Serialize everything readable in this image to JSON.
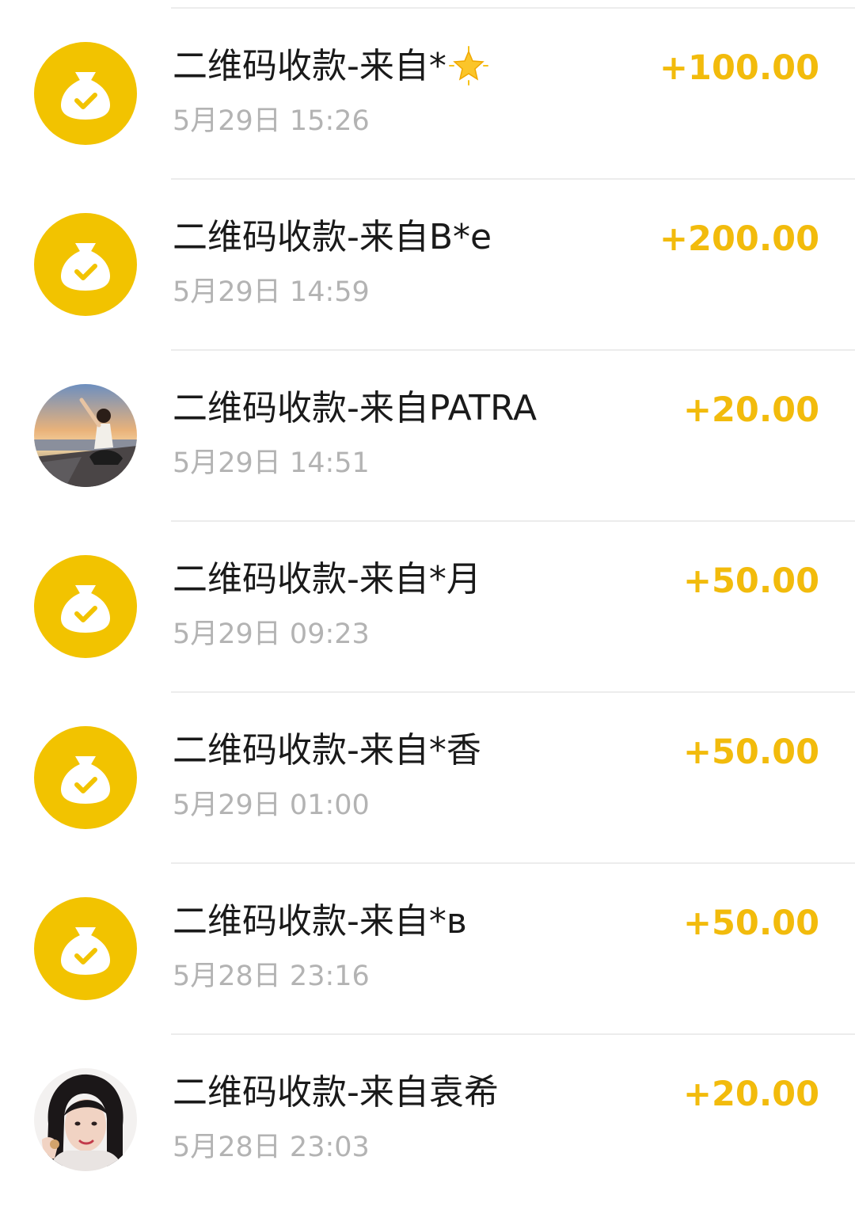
{
  "colors": {
    "accent_amount": "#f2bb0c",
    "avatar_yellow": "#f2c300",
    "title_text": "#1a1a1a",
    "time_text": "#b3b3b3",
    "divider": "#ececec"
  },
  "transactions": [
    {
      "title": "二维码收款-来自*",
      "title_emoji": "star-emoji",
      "time": "5月29日 15:26",
      "amount": "+100.00",
      "avatar_type": "money-bag-icon"
    },
    {
      "title": "二维码收款-来自B*e",
      "time": "5月29日 14:59",
      "amount": "+200.00",
      "avatar_type": "money-bag-icon"
    },
    {
      "title": "二维码收款-来自PATRA",
      "time": "5月29日 14:51",
      "amount": "+20.00",
      "avatar_type": "user-photo-beach"
    },
    {
      "title": "二维码收款-来自*月",
      "time": "5月29日 09:23",
      "amount": "+50.00",
      "avatar_type": "money-bag-icon"
    },
    {
      "title": "二维码收款-来自*香",
      "time": "5月29日 01:00",
      "amount": "+50.00",
      "avatar_type": "money-bag-icon"
    },
    {
      "title": "二维码收款-来自*в",
      "time": "5月28日 23:16",
      "amount": "+50.00",
      "avatar_type": "money-bag-icon"
    },
    {
      "title": "二维码收款-来自袁希",
      "time": "5月28日 23:03",
      "amount": "+20.00",
      "avatar_type": "user-photo-portrait"
    }
  ]
}
